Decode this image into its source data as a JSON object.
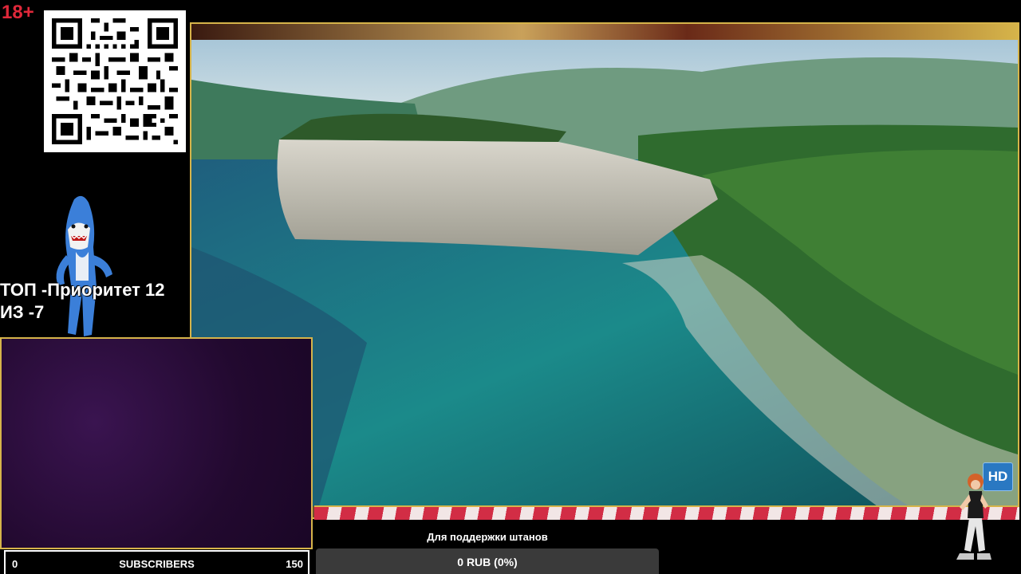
{
  "overlay": {
    "age_badge": "18+",
    "top_line1": "ТОП -Приоритет 12",
    "top_line2": "ИЗ -7",
    "hd_badge": "HD"
  },
  "subscribers": {
    "min": "0",
    "label": "SUBSCRIBERS",
    "max": "150",
    "current_fraction": 0
  },
  "donation": {
    "title": "Для поддержки штанов",
    "progress_text": "0 RUB (0%)",
    "progress_fraction": 0
  },
  "colors": {
    "frame_gold": "#d6b44a",
    "age_red": "#e0283a",
    "panel_purple": "#22092f",
    "hd_blue": "#2a78c2"
  },
  "icons": {
    "qr": "qr-code-icon",
    "mascot": "shark-mascot-icon",
    "dancer": "dancer-figure-icon"
  }
}
